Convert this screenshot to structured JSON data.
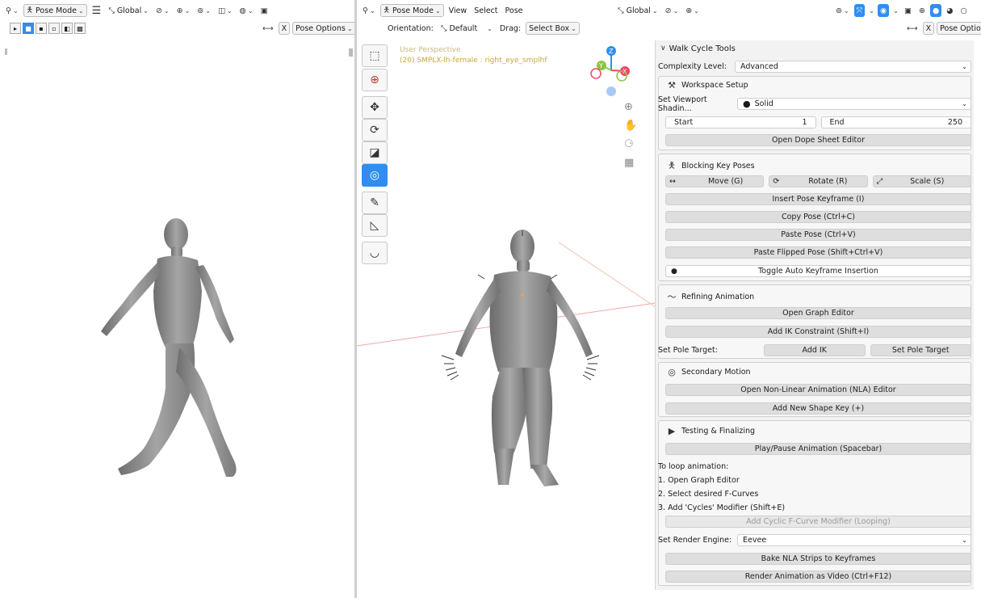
{
  "left_header": {
    "mode": "Pose Mode",
    "orientation": "Global",
    "pose_options": "Pose Options",
    "x_label": "X"
  },
  "right_header": {
    "mode": "Pose Mode",
    "menus": [
      "View",
      "Select",
      "Pose"
    ],
    "orientation": "Global",
    "pose_options": "Pose Options",
    "x_label": "X",
    "orientation_label": "Orientation:",
    "orientation_value": "Default",
    "drag_label": "Drag:",
    "drag_value": "Select Box"
  },
  "viewport": {
    "perspective": "User Perspective",
    "object_info": "(20) SMPLX-lh-female : right_eye_smplhf"
  },
  "gizmo": {
    "z": "Z",
    "y": "Y",
    "x": "X"
  },
  "icons": {
    "select": "cursor-arrow-icon",
    "cursor": "3d-cursor-icon",
    "move": "move-arrows-icon",
    "rotate": "rotate-icon",
    "scale": "scale-icon",
    "transform": "transform-icon",
    "annotate": "annotate-pen-icon",
    "measure": "measure-ruler-icon",
    "relax": "relax-curve-icon"
  },
  "colors": {
    "accent": "#2f8ef0",
    "axis_x": "#f0476a",
    "axis_y": "#8cc63f",
    "axis_z": "#2f8ef0"
  },
  "panel": {
    "title": "Walk Cycle Tools",
    "complexity_label": "Complexity Level:",
    "complexity_value": "Advanced",
    "workspace": {
      "title": "Workspace Setup",
      "shading_label": "Set Viewport Shadin...",
      "shading_value": "Solid",
      "start_label": "Start",
      "start_value": "1",
      "end_label": "End",
      "end_value": "250",
      "dope_sheet": "Open Dope Sheet Editor"
    },
    "blocking": {
      "title": "Blocking Key Poses",
      "move": "Move (G)",
      "rotate": "Rotate (R)",
      "scale": "Scale (S)",
      "insert_keyframe": "Insert Pose Keyframe (I)",
      "copy_pose": "Copy Pose (Ctrl+C)",
      "paste_pose": "Paste Pose (Ctrl+V)",
      "paste_flipped": "Paste Flipped Pose (Shift+Ctrl+V)",
      "auto_keyframe": "Toggle Auto Keyframe Insertion"
    },
    "refining": {
      "title": "Refining Animation",
      "graph_editor": "Open Graph Editor",
      "ik_constraint": "Add IK Constraint (Shift+I)",
      "pole_label": "Set Pole Target:",
      "add_ik": "Add IK",
      "set_pole": "Set Pole Target"
    },
    "secondary": {
      "title": "Secondary Motion",
      "nla_editor": "Open Non-Linear Animation (NLA) Editor",
      "shape_key": "Add New Shape Key (+)"
    },
    "testing": {
      "title": "Testing & Finalizing",
      "play_pause": "Play/Pause Animation (Spacebar)",
      "loop_title": "To loop animation:",
      "loop_step1": "1. Open Graph Editor",
      "loop_step2": "2. Select desired F-Curves",
      "loop_step3": "3. Add 'Cycles' Modifier (Shift+E)",
      "cyclic_modifier": "Add Cyclic F-Curve Modifier (Looping)",
      "render_engine_label": "Set Render Engine:",
      "render_engine_value": "Eevee",
      "bake_nla": "Bake NLA Strips to Keyframes",
      "render_video": "Render Animation as Video (Ctrl+F12)"
    }
  }
}
